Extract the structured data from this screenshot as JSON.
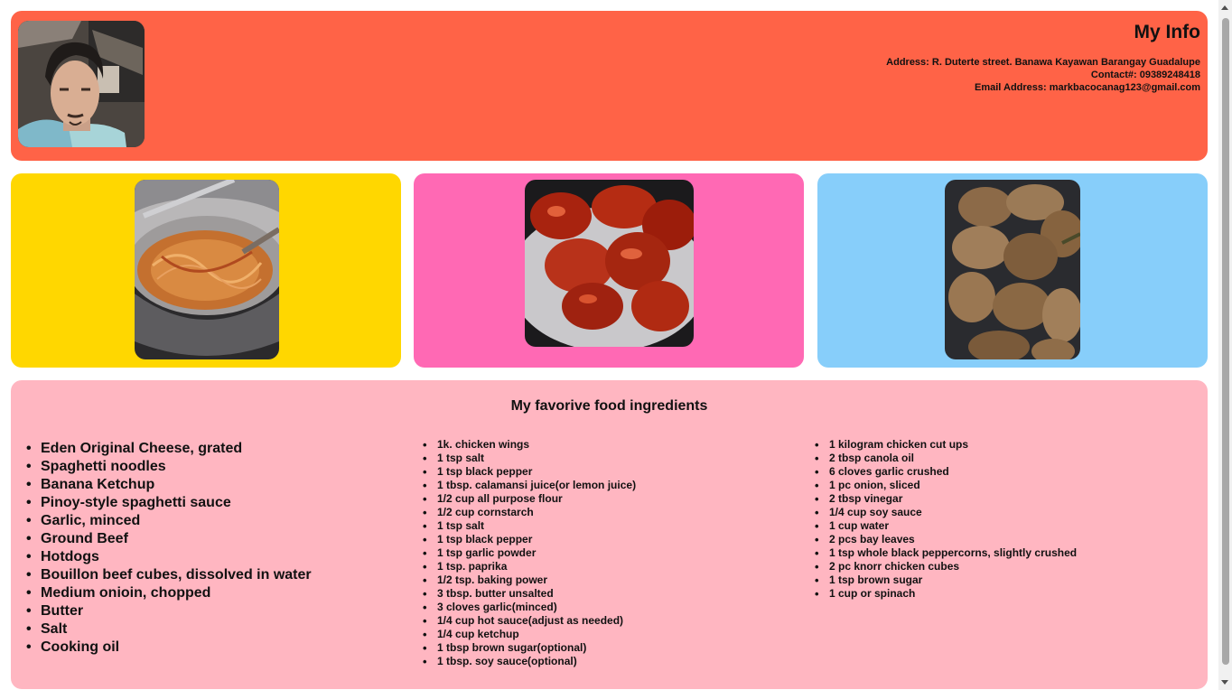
{
  "header": {
    "title": "My Info",
    "address": "Address: R. Duterte street. Banawa Kayawan Barangay Guadalupe",
    "contact": "Contact#: 09389248418",
    "email": "Email Address: markbacocanag123@gmail.com"
  },
  "colors": {
    "header_bg": "#ff6347",
    "card_1": "#ffd700",
    "card_2": "#ff69b4",
    "card_3": "#87cefa",
    "ingredients_bg": "#ffb6c1"
  },
  "ingredients": {
    "title": "My favorive food ingredients",
    "spaghetti": [
      "Eden Original Cheese, grated",
      "Spaghetti noodles",
      "Banana Ketchup",
      "Pinoy-style spaghetti sauce",
      "Garlic, minced",
      "Ground Beef",
      "Hotdogs",
      "Bouillon beef cubes, dissolved in water",
      "Medium onioin, chopped",
      "Butter",
      "Salt",
      "Cooking oil"
    ],
    "wings": [
      "1k. chicken wings",
      "1 tsp salt",
      "1 tsp black pepper",
      "1 tbsp. calamansi juice(or lemon juice)",
      "1/2 cup all purpose flour",
      "1/2 cup cornstarch",
      "1 tsp salt",
      "1 tsp black pepper",
      "1 tsp garlic powder",
      "1 tsp. paprika",
      "1/2 tsp. baking power",
      "3 tbsp. butter unsalted",
      "3 cloves garlic(minced)",
      "1/4 cup hot sauce(adjust as needed)",
      "1/4 cup ketchup",
      "1 tbsp brown sugar(optional)",
      "1 tbsp. soy sauce(optional)"
    ],
    "adobo": [
      "1 kilogram chicken cut ups",
      "2 tbsp canola oil",
      "6 cloves garlic crushed",
      "1 pc onion, sliced",
      "2 tbsp vinegar",
      "1/4 cup soy sauce",
      "1 cup water",
      "2 pcs bay leaves",
      "1 tsp whole black peppercorns, slightly crushed",
      "2 pc knorr chicken cubes",
      "1 tsp brown sugar",
      "1 cup or spinach"
    ]
  }
}
